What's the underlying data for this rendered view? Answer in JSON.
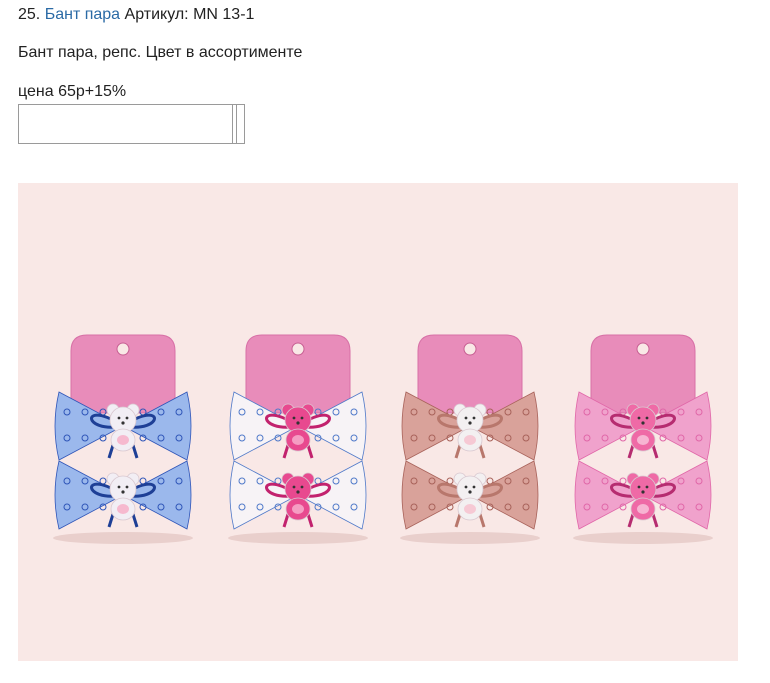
{
  "product": {
    "number": "25.",
    "name": "Бант пара",
    "sku_label": "Артикул: MN 13-1",
    "description": "Бант пара, репс. Цвет в ассортименте",
    "price": "цена 65р+15%"
  },
  "quantity_field": {
    "value": "",
    "placeholder": ""
  },
  "product_image": {
    "variants": [
      {
        "card": "#e88cba",
        "ribbon": "#9bb8ec",
        "pattern": "#2f55b8",
        "loop": "#1e3f96",
        "bear": "#f2eef4",
        "bear_face": "#f6b9cf"
      },
      {
        "card": "#e88cba",
        "ribbon": "#f7f3f6",
        "pattern": "#4f79c9",
        "loop": "#c2226e",
        "bear": "#e8498f",
        "bear_face": "#f59dc3"
      },
      {
        "card": "#e88cba",
        "ribbon": "#d9a29a",
        "pattern": "#a8625a",
        "loop": "#b8776c",
        "bear": "#f3f0f1",
        "bear_face": "#f6c9d4"
      },
      {
        "card": "#e88cba",
        "ribbon": "#f0a2cc",
        "pattern": "#e067a8",
        "loop": "#b62c70",
        "bear": "#ef6aa6",
        "bear_face": "#f7b4d2"
      }
    ]
  }
}
